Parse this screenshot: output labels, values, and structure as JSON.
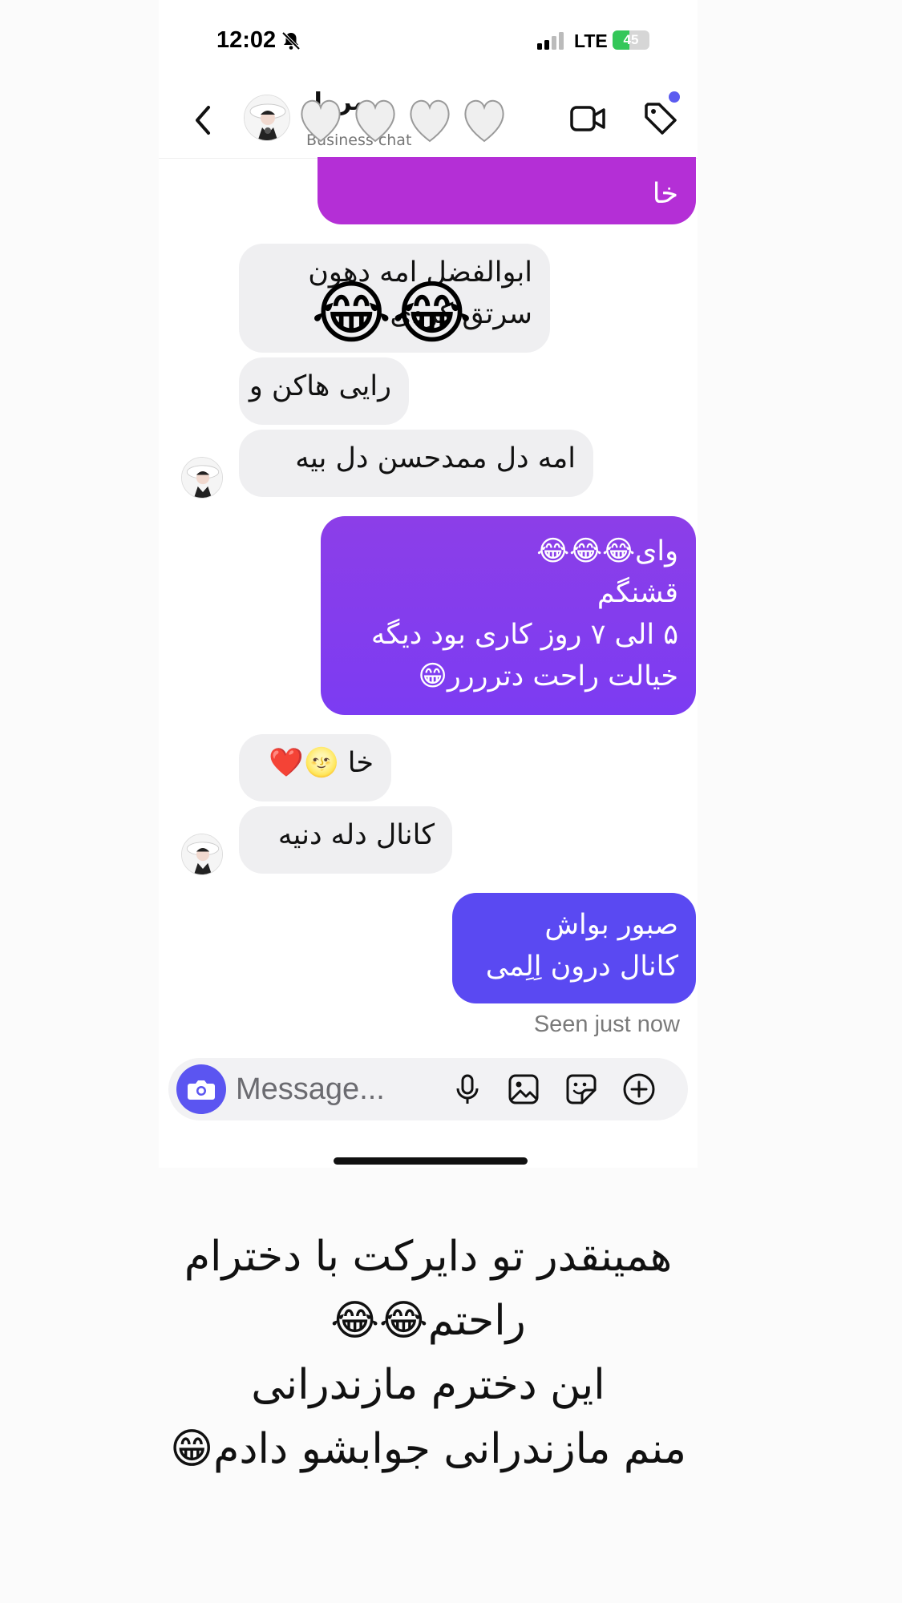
{
  "status_bar": {
    "time": "12:02",
    "network": "LTE",
    "battery": "45",
    "battery_fraction": 0.45,
    "accent_battery": "#34c759"
  },
  "header": {
    "contact_name": "مرمل",
    "subtitle": "Business chat",
    "overlay_emoji": "🤍🤍🤍🤍"
  },
  "messages": {
    "top_partial": [
      "خا"
    ],
    "in_1": [
      "ابوالفضل امه دهون",
      "سرتق کردی"
    ],
    "in_1_overlay": "😂😂",
    "in_2": "رایی هاکن و",
    "in_3": "امه دل ممدحسن دل بیه",
    "out_1": [
      "وای😂😂😂",
      "قشنگم",
      "۵ الی ۷ روز کاری بود دیگه",
      "خیالت راحت دترررر😁"
    ],
    "in_4": "خا 🌝❤️",
    "in_5": "کانال دله دنیه",
    "out_2": [
      "صبور بواش",
      "کانال درون اِلِمی"
    ],
    "seen": "Seen just now"
  },
  "composer": {
    "placeholder": "Message..."
  },
  "caption": {
    "lines": [
      "همینقدر تو دایرکت با دخترام",
      "راحتم😂😂",
      "این دخترم مازندرانی",
      "منم مازندرانی جوابشو دادم😁"
    ]
  },
  "colors": {
    "out_bubble_top": "#b42fd6",
    "out_bubble_mid": "#8a3cf0",
    "out_bubble_bottom": "#5a49f2",
    "in_bubble": "#efeff1",
    "accent": "#5b55f1"
  },
  "icons": [
    "bell-slash-icon",
    "signal-icon",
    "battery-icon",
    "back-chevron-icon",
    "video-call-icon",
    "tag-icon",
    "camera-icon",
    "microphone-icon",
    "gallery-icon",
    "sticker-icon",
    "plus-circle-icon"
  ]
}
